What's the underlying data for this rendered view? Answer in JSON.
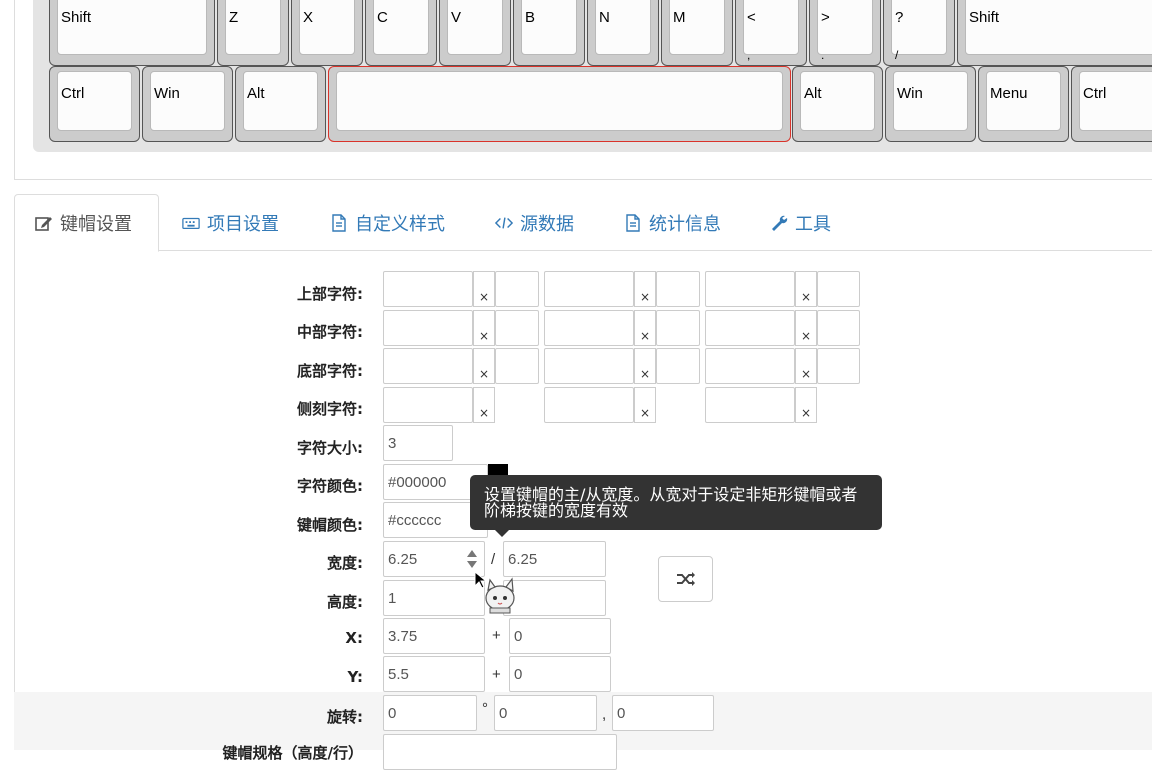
{
  "keyboard": {
    "row_shift": [
      {
        "top": "Shift",
        "bottom": ""
      },
      {
        "top": "Z",
        "bottom": ""
      },
      {
        "top": "X",
        "bottom": ""
      },
      {
        "top": "C",
        "bottom": ""
      },
      {
        "top": "V",
        "bottom": ""
      },
      {
        "top": "B",
        "bottom": ""
      },
      {
        "top": "N",
        "bottom": ""
      },
      {
        "top": "M",
        "bottom": ""
      },
      {
        "top": "<",
        "bottom": ","
      },
      {
        "top": ">",
        "bottom": "."
      },
      {
        "top": "?",
        "bottom": "/"
      },
      {
        "top": "Shift",
        "bottom": ""
      }
    ],
    "row_ctrl": [
      {
        "top": "Ctrl"
      },
      {
        "top": "Win"
      },
      {
        "top": "Alt"
      },
      {
        "top": ""
      },
      {
        "top": "Alt"
      },
      {
        "top": "Win"
      },
      {
        "top": "Menu"
      },
      {
        "top": "Ctrl"
      }
    ],
    "selected_color": "#d9332a"
  },
  "tabs": [
    {
      "label": "键帽设置",
      "icon": "edit-icon",
      "active": true
    },
    {
      "label": "项目设置",
      "icon": "keyboard-icon",
      "active": false
    },
    {
      "label": "自定义样式",
      "icon": "file-icon",
      "active": false
    },
    {
      "label": "源数据",
      "icon": "code-icon",
      "active": false
    },
    {
      "label": "统计信息",
      "icon": "file-text-icon",
      "active": false
    },
    {
      "label": "工具",
      "icon": "wrench-icon",
      "active": false
    }
  ],
  "form": {
    "top_legend": "上部字符:",
    "center_legend": "中部字符:",
    "bottom_legend": "底部字符:",
    "side_legend": "侧刻字符:",
    "text_size": {
      "label": "字符大小:",
      "value": "3"
    },
    "text_color": {
      "label": "字符颜色:",
      "value": "#000000"
    },
    "key_color": {
      "label": "键帽颜色:",
      "value": "#cccccc"
    },
    "width": {
      "label": "宽度:",
      "primary": "6.25",
      "separator": "/",
      "secondary": "6.25"
    },
    "height": {
      "label": "高度:",
      "primary": "1"
    },
    "x": {
      "label": "X:",
      "value": "3.75",
      "plus": "+",
      "offset": "0"
    },
    "y": {
      "label": "Y:",
      "value": "5.5",
      "plus": "+",
      "offset": "0"
    },
    "rotation": {
      "label": "旋转:",
      "angle": "0",
      "degree": "°",
      "cx": "0",
      "comma": ",",
      "cy": "0"
    },
    "next_label": "键帽规格（高度/行）",
    "clear_glyph": "×"
  },
  "tooltip": {
    "text": "设置键帽的主/从宽度。从宽对于设定非矩形键帽或者阶梯按键的宽度有效"
  }
}
